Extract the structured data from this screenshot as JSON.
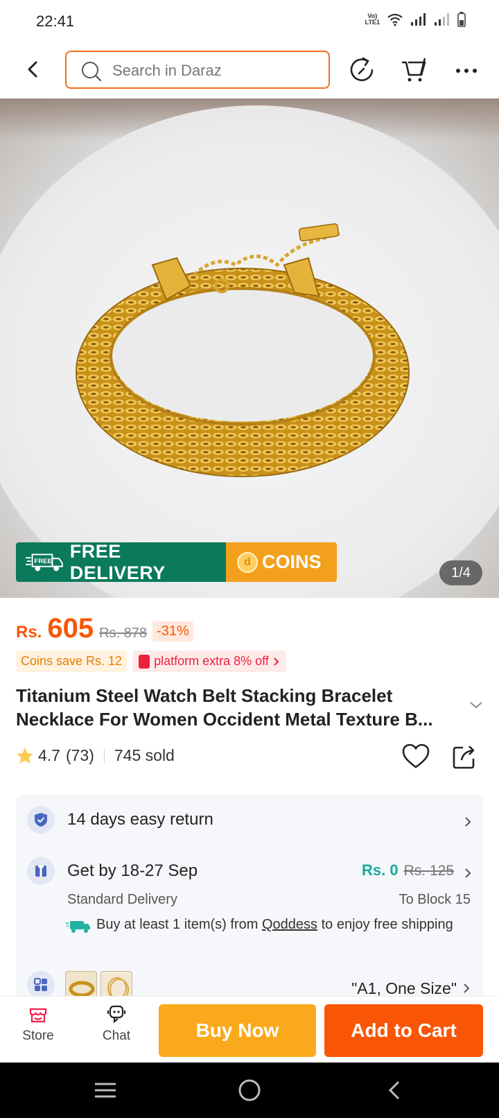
{
  "status": {
    "time": "22:41",
    "network": "VoLTE1"
  },
  "search": {
    "placeholder": "Search in Daraz"
  },
  "hero": {
    "badge_free_icon": "FREE",
    "badge_free": "FREE DELIVERY",
    "badge_coins": "COINS",
    "page_indicator": "1/4"
  },
  "price": {
    "currency": "Rs.",
    "amount": "605",
    "original": "Rs. 878",
    "discount": "-31%"
  },
  "promos": {
    "coins": "Coins save Rs. 12",
    "platform": "platform extra 8% off"
  },
  "product": {
    "title": "Titanium Steel Watch Belt Stacking Bracelet Necklace For Women Occident Metal Texture B...",
    "rating": "4.7",
    "reviews": "(73)",
    "sold": "745 sold"
  },
  "info": {
    "return": "14 days easy return",
    "delivery": "Get by 18-27 Sep",
    "delivery_price": "Rs. 0",
    "delivery_old_price": "Rs. 125",
    "delivery_type": "Standard Delivery",
    "delivery_to": "To Block 15",
    "free_note_pre": "Buy at least 1 item(s) from ",
    "free_note_store": "Qoddess",
    "free_note_post": " to enjoy free shipping",
    "variant": "\"A1, One Size\""
  },
  "actions": {
    "store": "Store",
    "chat": "Chat",
    "buy_now": "Buy Now",
    "add_to_cart": "Add to Cart"
  },
  "colors": {
    "accent": "#f85606",
    "buy": "#fba91c",
    "delivery_green": "#0b7a5a"
  }
}
